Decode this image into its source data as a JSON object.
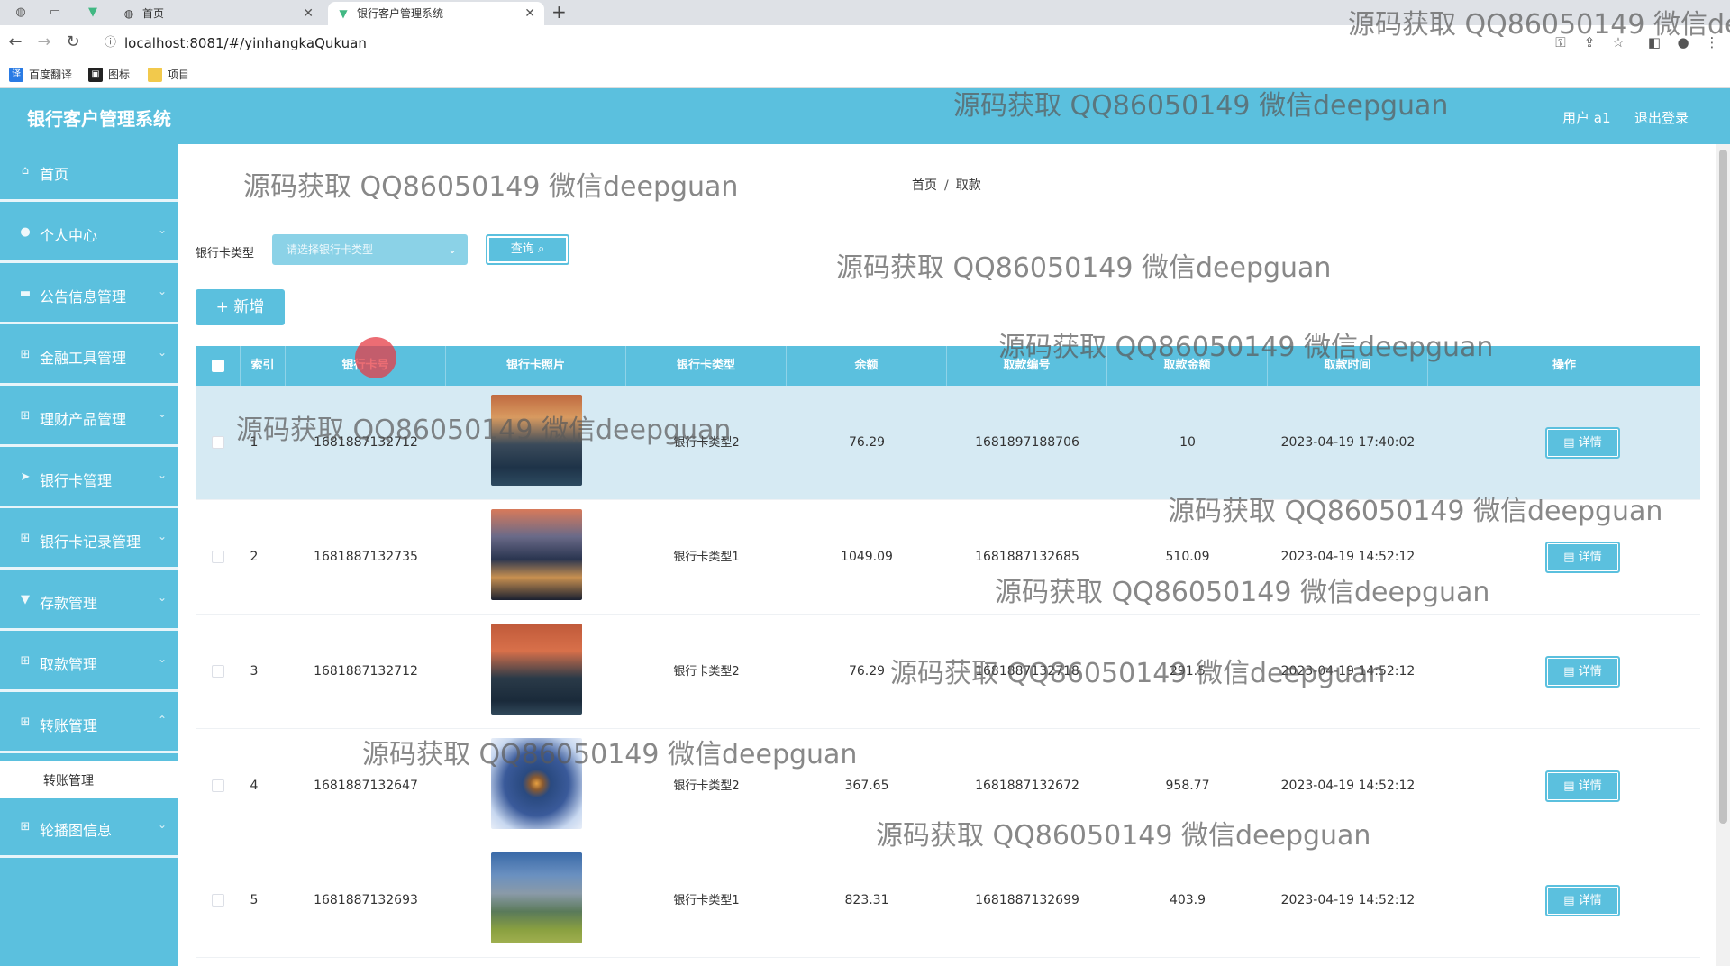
{
  "browser": {
    "tabs": [
      {
        "title": "首页"
      },
      {
        "title": "银行客户管理系统"
      }
    ],
    "url": "localhost:8081/#/yinhangkaQukuan",
    "bookmarks": [
      "百度翻译",
      "图标",
      "项目"
    ]
  },
  "header": {
    "title": "银行客户管理系统",
    "user": "用户 a1",
    "logout": "退出登录"
  },
  "sidebar": {
    "items": [
      {
        "label": "首页",
        "icon": "home-icon"
      },
      {
        "label": "个人中心",
        "icon": "user-icon"
      },
      {
        "label": "公告信息管理",
        "icon": "notice-icon"
      },
      {
        "label": "金融工具管理",
        "icon": "grid-icon"
      },
      {
        "label": "理财产品管理",
        "icon": "grid-icon"
      },
      {
        "label": "银行卡管理",
        "icon": "send-icon"
      },
      {
        "label": "银行卡记录管理",
        "icon": "grid-icon"
      },
      {
        "label": "存款管理",
        "icon": "deposit-icon"
      },
      {
        "label": "取款管理",
        "icon": "grid-icon"
      },
      {
        "label": "转账管理",
        "icon": "grid-icon"
      },
      {
        "label": "轮播图信息",
        "icon": "grid-icon"
      }
    ],
    "subitem": "转账管理"
  },
  "breadcrumb": {
    "home": "首页",
    "sep": "/",
    "current": "取款"
  },
  "filter": {
    "label": "银行卡类型",
    "placeholder": "请选择银行卡类型",
    "query_label": "查询",
    "add_label": "+ 新增"
  },
  "table": {
    "headers": [
      "索引",
      "银行卡号",
      "银行卡照片",
      "银行卡类型",
      "余额",
      "取款编号",
      "取款金额",
      "取款时间",
      "操作"
    ],
    "detail_label": "详情",
    "rows": [
      {
        "index": "1",
        "card_no": "1681887132712",
        "photo": "lake-sunset",
        "type": "银行卡类型2",
        "balance": "76.29",
        "withdraw_no": "1681897188706",
        "amount": "10",
        "time": "2023-04-19 17:40:02"
      },
      {
        "index": "2",
        "card_no": "1681887132735",
        "photo": "city-mountain-night",
        "type": "银行卡类型1",
        "balance": "1049.09",
        "withdraw_no": "1681887132685",
        "amount": "510.09",
        "time": "2023-04-19 14:52:12"
      },
      {
        "index": "3",
        "card_no": "1681887132712",
        "photo": "lake-moonrise",
        "type": "银行卡类型2",
        "balance": "76.29",
        "withdraw_no": "1681887132718",
        "amount": "291.5",
        "time": "2023-04-19 14:52:12"
      },
      {
        "index": "4",
        "card_no": "1681887132647",
        "photo": "snow-cabin",
        "type": "银行卡类型2",
        "balance": "367.65",
        "withdraw_no": "1681887132672",
        "amount": "958.77",
        "time": "2023-04-19 14:52:12"
      },
      {
        "index": "5",
        "card_no": "1681887132693",
        "photo": "mountain-meadow",
        "type": "银行卡类型1",
        "balance": "823.31",
        "withdraw_no": "1681887132699",
        "amount": "403.9",
        "time": "2023-04-19 14:52:12"
      }
    ]
  },
  "watermark": "源码获取 QQ86050149 微信deepguan",
  "watermark_cut": "源码获取 QQ86050149 微信de",
  "colors": {
    "accent": "#5bc0de",
    "highlight_row": "#d6eaf3"
  }
}
